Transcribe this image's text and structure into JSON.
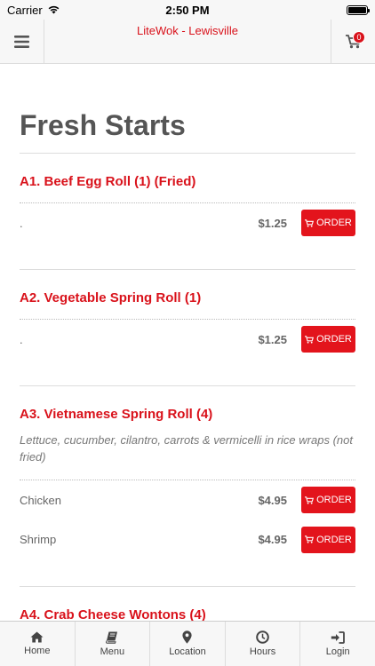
{
  "status_bar": {
    "carrier": "Carrier",
    "time": "2:50 PM"
  },
  "header": {
    "title": "LiteWok - Lewisville",
    "cart_count": "0"
  },
  "page": {
    "title": "Fresh Starts"
  },
  "items": [
    {
      "title": "A1. Beef Egg Roll (1) (Fried)",
      "options": [
        {
          "name": ".",
          "price": "$1.25",
          "button": "ORDER"
        }
      ]
    },
    {
      "title": "A2. Vegetable Spring Roll (1)",
      "options": [
        {
          "name": ".",
          "price": "$1.25",
          "button": "ORDER"
        }
      ]
    },
    {
      "title": "A3. Vietnamese Spring Roll (4)",
      "description": "Lettuce, cucumber, cilantro, carrots & vermicelli in rice wraps (not fried)",
      "options": [
        {
          "name": "Chicken",
          "price": "$4.95",
          "button": "ORDER"
        },
        {
          "name": "Shrimp",
          "price": "$4.95",
          "button": "ORDER"
        }
      ]
    },
    {
      "title": "A4. Crab Cheese Wontons (4)"
    }
  ],
  "tabs": [
    {
      "label": "Home",
      "icon": "home-icon"
    },
    {
      "label": "Menu",
      "icon": "book-icon"
    },
    {
      "label": "Location",
      "icon": "map-pin-icon"
    },
    {
      "label": "Hours",
      "icon": "clock-icon"
    },
    {
      "label": "Login",
      "icon": "login-icon"
    }
  ],
  "colors": {
    "accent": "#d9121b",
    "button": "#e3141c",
    "bar_bg": "#f7f7f7"
  }
}
